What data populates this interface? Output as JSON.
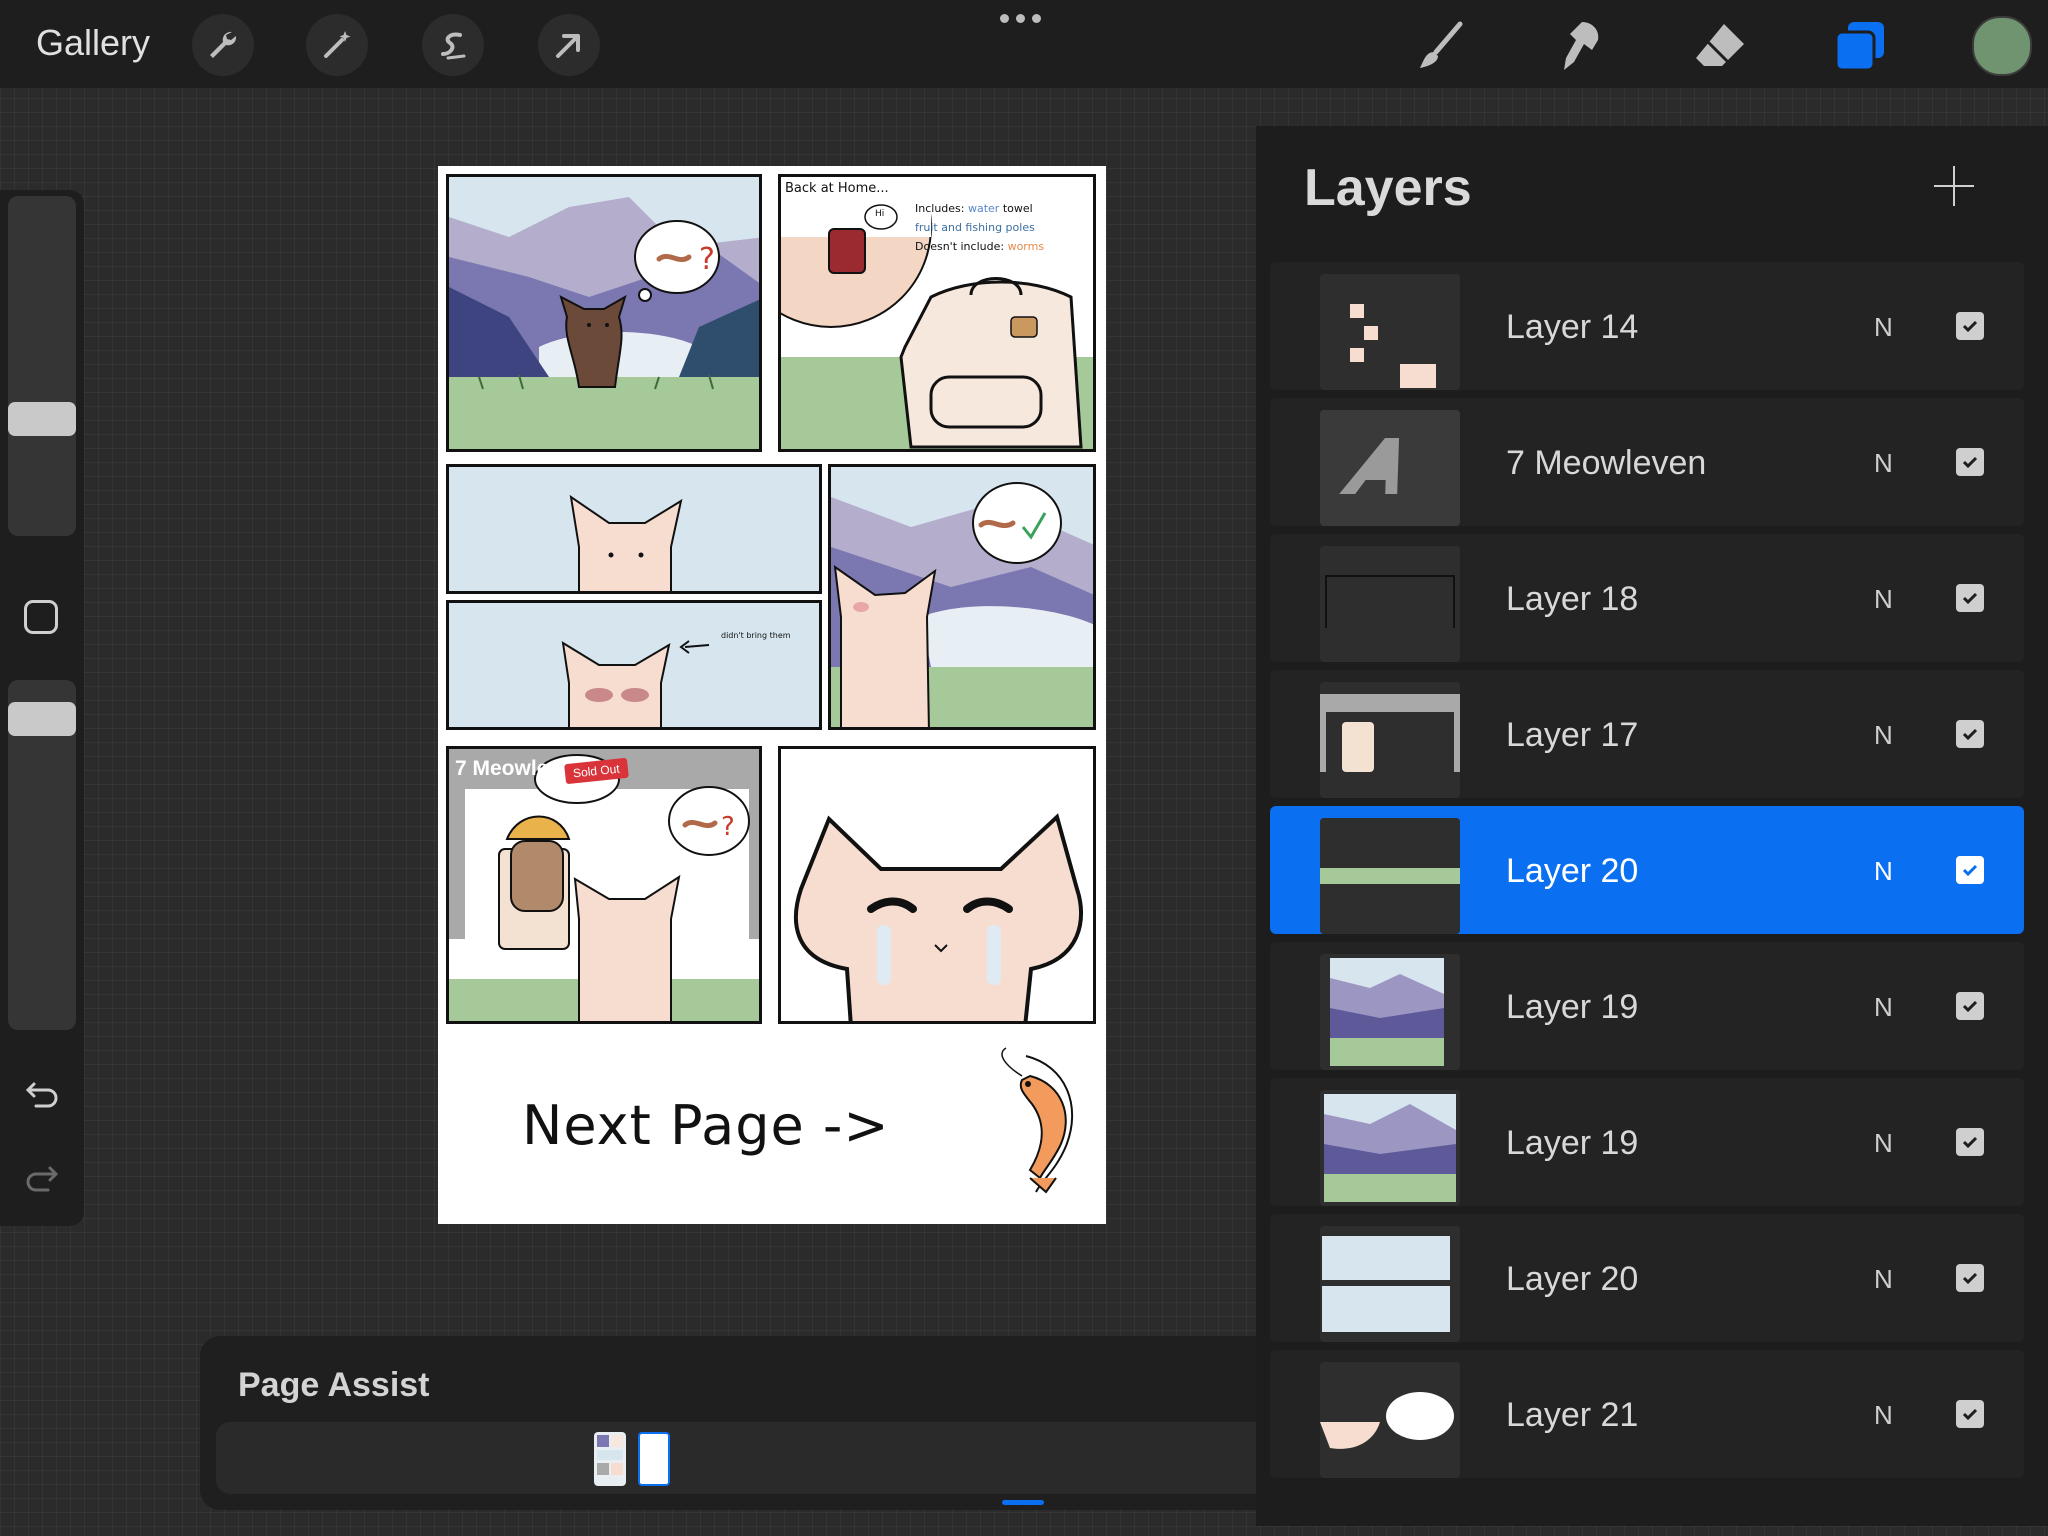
{
  "toolbar": {
    "gallery_label": "Gallery",
    "left_tools": [
      "wrench-icon",
      "magic-wand-icon",
      "selection-icon",
      "transform-arrow-icon"
    ],
    "right_tools": [
      "brush-icon",
      "smudge-icon",
      "eraser-icon",
      "layers-icon"
    ],
    "active_tool": "layers-icon",
    "current_color": "#6f946f",
    "accent_color": "#0a6ff0"
  },
  "canvas": {
    "panel2_caption": "Back at Home...",
    "panel2_small_bubble": "Hi",
    "includes_label": "Includes:",
    "includes_water": "water",
    "includes_towel": "towel",
    "includes_line2": "fruit and fishing poles",
    "doesnt_include_label": "Doesn't include:",
    "doesnt_include_worms": "worms",
    "panel4_caption": "didn't bring them",
    "store_sign": "7 Meowleve",
    "sold_out": "Sold Out",
    "next_page": "Next Page ->"
  },
  "layers": {
    "title": "Layers",
    "add_icon": "plus-icon",
    "items": [
      {
        "name": "Layer 14",
        "blend": "N",
        "visible": true,
        "selected": false
      },
      {
        "name": "7 Meowleven",
        "blend": "N",
        "visible": true,
        "selected": false
      },
      {
        "name": "Layer 18",
        "blend": "N",
        "visible": true,
        "selected": false
      },
      {
        "name": "Layer 17",
        "blend": "N",
        "visible": true,
        "selected": false
      },
      {
        "name": "Layer 20",
        "blend": "N",
        "visible": true,
        "selected": true
      },
      {
        "name": "Layer 19",
        "blend": "N",
        "visible": true,
        "selected": false
      },
      {
        "name": "Layer 19",
        "blend": "N",
        "visible": true,
        "selected": false
      },
      {
        "name": "Layer 20",
        "blend": "N",
        "visible": true,
        "selected": false
      },
      {
        "name": "Layer 21",
        "blend": "N",
        "visible": true,
        "selected": false
      }
    ]
  },
  "page_assist": {
    "title": "Page Assist",
    "pages": 2,
    "active_page": 2
  }
}
